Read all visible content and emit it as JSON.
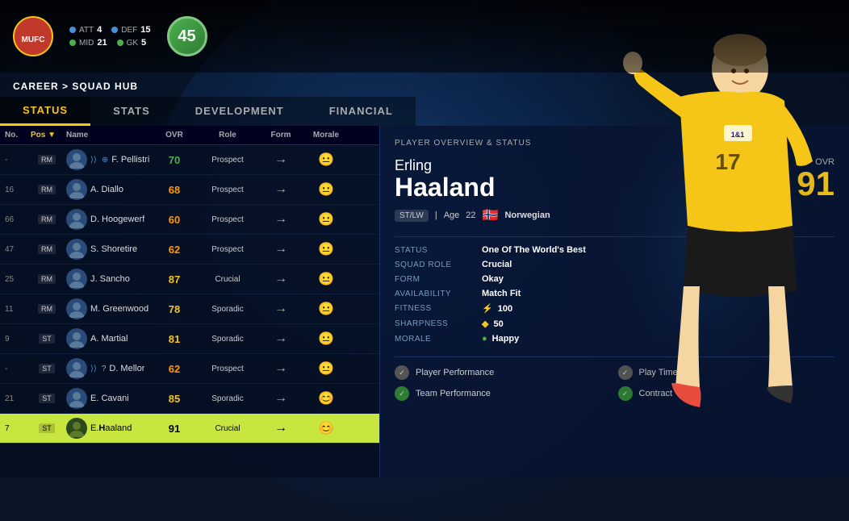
{
  "background": {
    "color": "#0a1628"
  },
  "header": {
    "team": "Man Utd",
    "stats": {
      "att": {
        "label": "ATT",
        "value": "4",
        "color": "blue"
      },
      "def": {
        "label": "DEF",
        "value": "15",
        "color": "blue"
      },
      "mid": {
        "label": "MID",
        "value": "21",
        "color": "green"
      },
      "gk": {
        "label": "GK",
        "value": "5",
        "color": "green"
      }
    },
    "overall": "45"
  },
  "breadcrumb": {
    "prefix": "CAREER > ",
    "current": "SQUAD HUB"
  },
  "tabs": [
    {
      "id": "status",
      "label": "STATUS",
      "active": true
    },
    {
      "id": "stats",
      "label": "STATS",
      "active": false
    },
    {
      "id": "development",
      "label": "DEVELOPMENT",
      "active": false
    },
    {
      "id": "financial",
      "label": "FINANCIAL",
      "active": false
    }
  ],
  "table": {
    "columns": [
      "No.",
      "Pos ▼",
      "Name",
      "OVR",
      "Role",
      "Form",
      "Morale"
    ],
    "rows": [
      {
        "no": "-",
        "pos": "RM",
        "name": "F. Pellistri",
        "bold_letter": "",
        "ovr": "70",
        "ovr_color": "green",
        "role": "Prospect",
        "form": "→",
        "morale": "neutral",
        "selected": false
      },
      {
        "no": "16",
        "pos": "RM",
        "name": "A. Diallo",
        "bold_letter": "",
        "ovr": "68",
        "ovr_color": "orange",
        "role": "Prospect",
        "form": "→",
        "morale": "neutral",
        "selected": false
      },
      {
        "no": "66",
        "pos": "RM",
        "name": "D. Hoogewerf",
        "bold_letter": "",
        "ovr": "60",
        "ovr_color": "orange",
        "role": "Prospect",
        "form": "→",
        "morale": "neutral",
        "selected": false
      },
      {
        "no": "47",
        "pos": "RM",
        "name": "S. Shoretire",
        "bold_letter": "",
        "ovr": "62",
        "ovr_color": "orange",
        "role": "Prospect",
        "form": "→",
        "morale": "neutral",
        "selected": false
      },
      {
        "no": "25",
        "pos": "RM",
        "name": "J. Sancho",
        "bold_letter": "",
        "ovr": "87",
        "ovr_color": "yellow",
        "role": "Crucial",
        "form": "→",
        "morale": "neutral",
        "selected": false
      },
      {
        "no": "11",
        "pos": "RM",
        "name": "M. Greenwood",
        "bold_letter": "",
        "ovr": "78",
        "ovr_color": "yellow",
        "role": "Sporadic",
        "form": "→",
        "morale": "neutral",
        "selected": false
      },
      {
        "no": "9",
        "pos": "ST",
        "name": "A. Martial",
        "bold_letter": "",
        "ovr": "81",
        "ovr_color": "yellow",
        "role": "Sporadic",
        "form": "→",
        "morale": "neutral",
        "selected": false
      },
      {
        "no": "-",
        "pos": "ST",
        "name": "D. Mellor",
        "bold_letter": "",
        "ovr": "62",
        "ovr_color": "orange",
        "role": "Prospect",
        "form": "→",
        "morale": "neutral",
        "selected": false
      },
      {
        "no": "21",
        "pos": "ST",
        "name": "E. Cavani",
        "bold_letter": "",
        "ovr": "85",
        "ovr_color": "yellow",
        "role": "Sporadic",
        "form": "→",
        "morale": "happy",
        "selected": false
      },
      {
        "no": "7",
        "pos": "ST",
        "name": "E.Haaland",
        "bold_letter": "H",
        "ovr": "91",
        "ovr_color": "green",
        "role": "Crucial",
        "form": "→",
        "morale": "happy",
        "selected": true
      }
    ]
  },
  "player_overview": {
    "title": "PLAYER OVERVIEW & STATUS",
    "first_name": "Erling",
    "last_name": "Haaland",
    "ovr_label": "OVR",
    "ovr_value": "91",
    "position": "ST/LW",
    "age_label": "Age",
    "age": "22",
    "flag": "🇳🇴",
    "nationality": "Norwegian",
    "stats": [
      {
        "label": "STATUS",
        "value": "One Of The World's Best"
      },
      {
        "label": "SQUAD ROLE",
        "value": "Crucial"
      },
      {
        "label": "FORM",
        "value": "Okay"
      },
      {
        "label": "AVAILABILITY",
        "value": "Match Fit"
      },
      {
        "label": "FITNESS",
        "value": "100",
        "icon": "lightning"
      },
      {
        "label": "SHARPNESS",
        "value": "50",
        "icon": "diamond"
      },
      {
        "label": "MORALE",
        "value": "Happy",
        "icon": "circle-green"
      }
    ],
    "objectives": [
      {
        "label": "Player Performance",
        "type": "gray"
      },
      {
        "label": "Play Time",
        "type": "gray"
      },
      {
        "label": "Team Performance",
        "type": "green"
      },
      {
        "label": "Contract",
        "type": "green"
      }
    ]
  }
}
